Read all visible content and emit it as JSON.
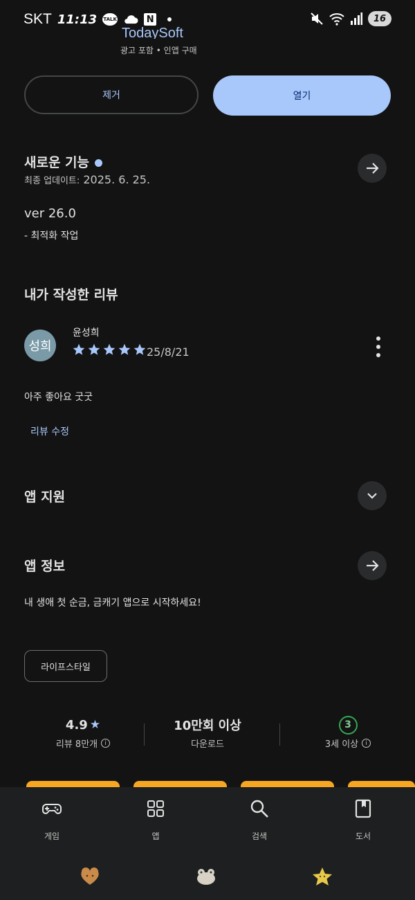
{
  "status_bar": {
    "carrier": "SKT",
    "time": "11:13",
    "talk_badge": "TALK",
    "n_badge": "N",
    "battery": "16"
  },
  "header": {
    "developer": "TodaySoft",
    "meta": "광고 포함 • 인앱 구매"
  },
  "actions": {
    "remove_label": "제거",
    "open_label": "열기"
  },
  "whats_new": {
    "title": "새로운 기능",
    "updated_label": "최종 업데이트:",
    "updated_date": "2025. 6. 25.",
    "version": "ver 26.0",
    "changes": "- 최적화 작업"
  },
  "my_review": {
    "title": "내가 작성한 리뷰",
    "avatar_text": "성희",
    "reviewer_name": "윤성희",
    "rating": 5,
    "date": "25/8/21",
    "text": "아주 좋아요 굿굿",
    "edit_label": "리뷰 수정"
  },
  "app_support": {
    "title": "앱 지원"
  },
  "app_info": {
    "title": "앱 정보",
    "description": "내 생애 첫 순금, 금캐기 앱으로 시작하세요!",
    "category_chip": "라이프스타일"
  },
  "stats": {
    "rating_value": "4.9",
    "rating_star": "★",
    "reviews_label": "리뷰 8만개",
    "downloads_value": "10만회 이상",
    "downloads_label": "다운로드",
    "age_badge": "3",
    "age_label": "3세 이상"
  },
  "bottom_nav": {
    "items": [
      {
        "label": "게임",
        "icon": "gamepad-icon"
      },
      {
        "label": "앱",
        "icon": "apps-grid-icon"
      },
      {
        "label": "검색",
        "icon": "search-icon"
      },
      {
        "label": "도서",
        "icon": "book-icon"
      }
    ]
  },
  "colors": {
    "background": "#131313",
    "accent": "#a8c7fa",
    "open_button_text": "#062e6f",
    "age_badge": "#34a853",
    "promo": "#f6a623"
  }
}
